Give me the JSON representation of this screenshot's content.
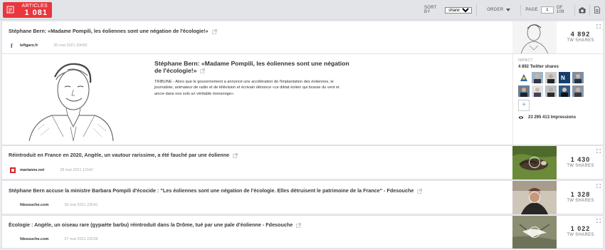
{
  "toolbar": {
    "articles_label": "ARTICLES",
    "articles_count": "1 081",
    "sort_by_label": "SORT BY",
    "sort_value": "shares",
    "sort_options": [
      "shares"
    ],
    "order_label": "ORDER",
    "page_label": "PAGE",
    "page_value": "1",
    "page_total": "OF 109",
    "camera_icon": "camera-icon",
    "export_icon": "document-export-icon"
  },
  "articles": [
    {
      "title": "Stéphane Bern: «Madame Pompili, les éoliennes sont une négation de l'écologie!»",
      "source": "lefigaro.fr",
      "date": "30 mai 2021 20h00",
      "shares": "4 892",
      "shares_label": "TW SHARES"
    },
    {
      "title": "Réintroduit en France en 2020, Angèle, un vautour rarissime, a été fauché par une éolienne",
      "source": "marianne.net",
      "date": "28 mai 2021 11h42",
      "shares": "1 430",
      "shares_label": "TW SHARES"
    },
    {
      "title": "Stéphane Bern accuse la ministre Barbara Pompili d'écocide : \"Les éoliennes sont une négation de l'écologie. Elles détruisent le patrimoine de la France\" - Fdesouche",
      "source": "fdesouche.com",
      "date": "30 mai 2021 22h41",
      "shares": "1 328",
      "shares_label": "TW SHARES"
    },
    {
      "title": "Écologie : Angèle, un oiseau rare (gypaète barbu) réintroduit dans la Drôme, tué par une pale d'éolienne - Fdesouche",
      "source": "fdesouche.com",
      "date": "27 mai 2021 22h28",
      "shares": "1 022",
      "shares_label": "TW SHARES"
    }
  ],
  "detail": {
    "title": "Stéphane Bern: «Madame Pompili, les éoliennes sont une négation de l'écologie!»",
    "body": "TRIBUNE - Alors que le gouvernement a annoncé une accélération de l'implantation des éoliennes, le journaliste, animateur de radio et de télévision et écrivain dénonce «ce diktat éolien qui brasse du vent et ancre dans nos sols un véritable mensonge».",
    "impact_label": "IMPACT",
    "twitter_shares": "4 892 Twitter shares",
    "plus_label": "+",
    "impressions": "23 295 413 Impressions"
  },
  "colors": {
    "accent": "#e8373e",
    "toolbar_bg": "#e2e4e8",
    "page_bg": "#e9ebee"
  }
}
